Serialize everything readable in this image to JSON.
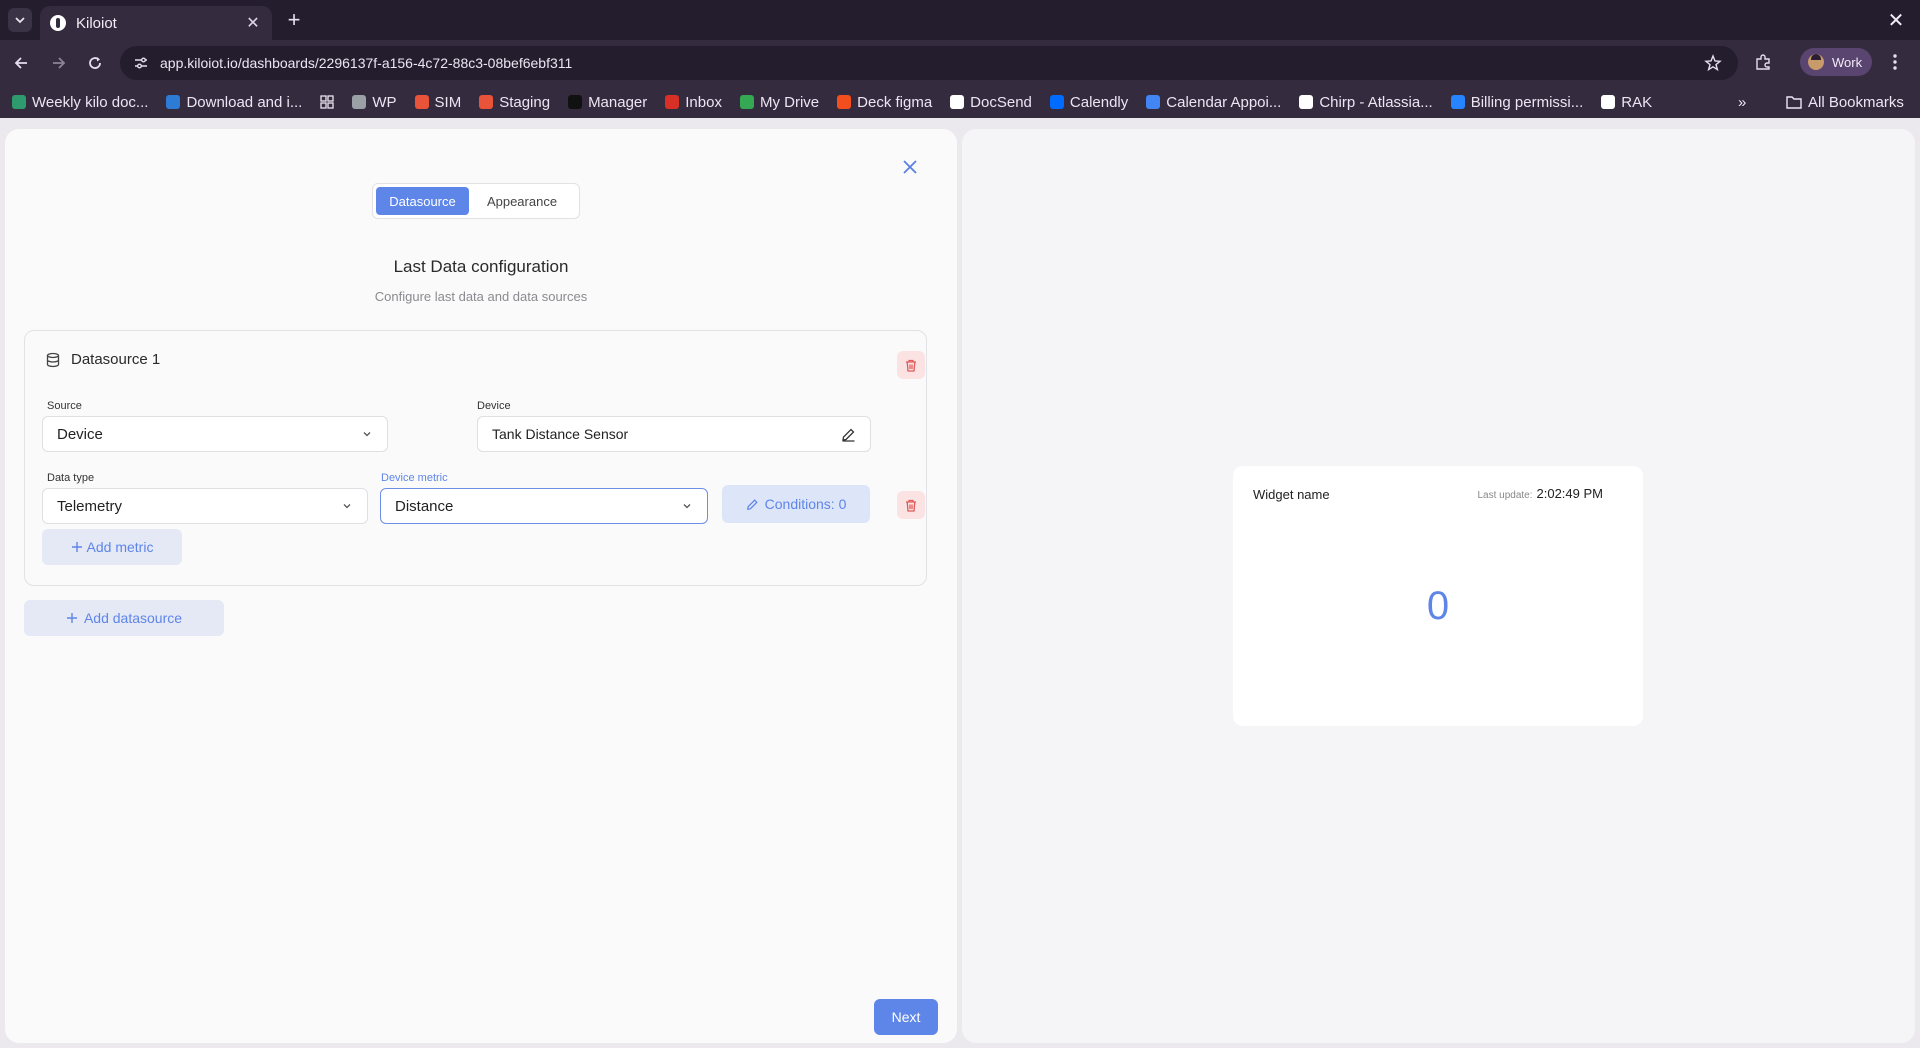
{
  "browser": {
    "tab_title": "Kiloiot",
    "tab_close": "✕",
    "new_tab": "+",
    "window_close": "✕",
    "url": "app.kiloiot.io/dashboards/2296137f-a156-4c72-88c3-08bef6ebf311",
    "profile_label": "Work",
    "bookmarks": [
      {
        "label": "Weekly kilo doc...",
        "color": "#2e9b6e"
      },
      {
        "label": "Download and i...",
        "color": "#2e7bd6"
      },
      {
        "label": "WP",
        "color": "#9aa0a6"
      },
      {
        "label": "SIM",
        "color": "#e8533a"
      },
      {
        "label": "Staging",
        "color": "#e8533a"
      },
      {
        "label": "Manager",
        "color": "#111111"
      },
      {
        "label": "Inbox",
        "color": "#d93025"
      },
      {
        "label": "My Drive",
        "color": "#34a853"
      },
      {
        "label": "Deck figma",
        "color": "#f24e1e"
      },
      {
        "label": "DocSend",
        "color": "#ffffff"
      },
      {
        "label": "Calendly",
        "color": "#006bff"
      },
      {
        "label": "Calendar Appoi...",
        "color": "#4285f4"
      },
      {
        "label": "Chirp - Atlassia...",
        "color": "#ffffff"
      },
      {
        "label": "Billing permissi...",
        "color": "#2684ff"
      },
      {
        "label": "RAK",
        "color": "#ffffff"
      }
    ],
    "more_bookmarks": "»",
    "all_bookmarks": "All Bookmarks"
  },
  "editor": {
    "tabs": [
      {
        "label": "Datasource",
        "active": true
      },
      {
        "label": "Appearance",
        "active": false
      }
    ],
    "title": "Last Data configuration",
    "subtitle": "Configure last data and data sources",
    "datasource": {
      "title": "Datasource 1",
      "source_label": "Source",
      "source_value": "Device",
      "device_label": "Device",
      "device_value": "Tank Distance Sensor",
      "data_type_label": "Data type",
      "data_type_value": "Telemetry",
      "metric_label": "Device metric",
      "metric_value": "Distance",
      "conditions_label": "Conditions: 0",
      "add_metric_label": "Add metric"
    },
    "add_datasource_label": "Add datasource",
    "next_label": "Next"
  },
  "preview": {
    "widget_name": "Widget name",
    "last_update_label": "Last update:",
    "last_update_value": "2:02:49 PM",
    "value": "0"
  },
  "colors": {
    "accent": "#5e85e8",
    "danger_bg": "#fbe3e3",
    "danger_icon": "#e05a5a",
    "chrome_bg": "#342b3f"
  }
}
